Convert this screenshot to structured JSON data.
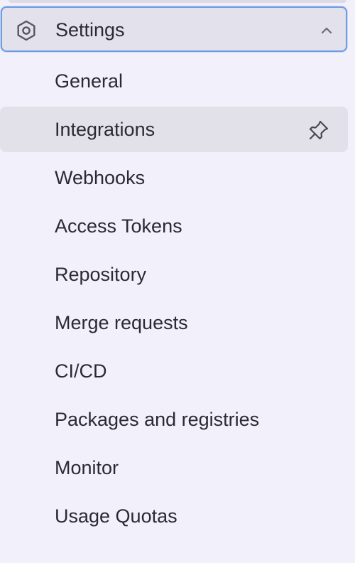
{
  "section": {
    "title": "Settings",
    "icon": "gear-icon",
    "expanded_icon": "chevron-up-icon",
    "accent_border": "#6f9be0"
  },
  "items": [
    {
      "label": "General"
    },
    {
      "label": "Integrations",
      "active": true,
      "action_icon": "pin-icon"
    },
    {
      "label": "Webhooks"
    },
    {
      "label": "Access Tokens"
    },
    {
      "label": "Repository"
    },
    {
      "label": "Merge requests"
    },
    {
      "label": "CI/CD"
    },
    {
      "label": "Packages and registries"
    },
    {
      "label": "Monitor"
    },
    {
      "label": "Usage Quotas"
    }
  ]
}
